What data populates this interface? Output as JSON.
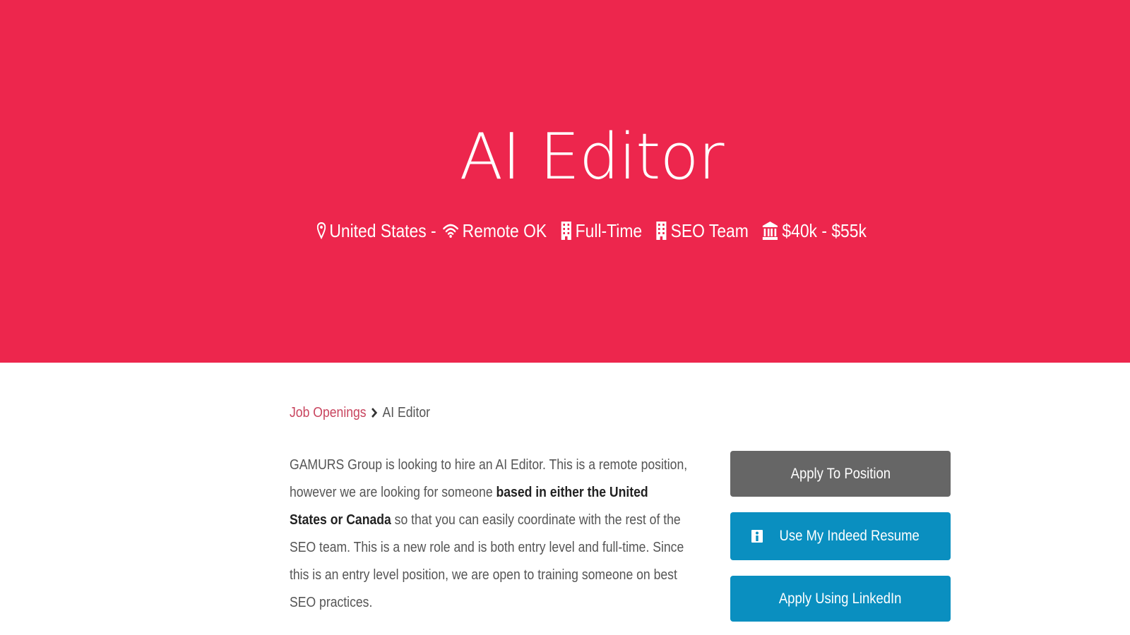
{
  "hero": {
    "title": "AI Editor",
    "location": "United States -",
    "remote": "Remote OK",
    "job_type": "Full-Time",
    "team": "SEO Team",
    "salary": "$40k - $55k",
    "background_color": "#ed264d"
  },
  "breadcrumb": {
    "parent": "Job Openings",
    "current": "AI Editor"
  },
  "description": {
    "part1": "GAMURS Group is looking to hire an AI Editor. This is a remote position, however we are looking for someone ",
    "bold": "based in either the United States or Canada",
    "part2": " so that you can easily coordinate with the rest of the SEO team. This is a new role and is both entry level and full-time. Since this is an entry level position, we are open to training someone on best SEO practices."
  },
  "actions": {
    "apply_label": "Apply To Position",
    "indeed_label": "Use My Indeed Resume",
    "linkedin_label": "Apply Using LinkedIn",
    "apply_color": "#666666",
    "partner_color": "#0a8fc0"
  },
  "icons": {
    "location": "map-marker-icon",
    "remote": "wifi-icon",
    "job_type": "building-icon",
    "team": "building-icon",
    "salary": "bank-icon",
    "breadcrumb_separator": "chevron-right-icon",
    "indeed": "info-icon"
  }
}
